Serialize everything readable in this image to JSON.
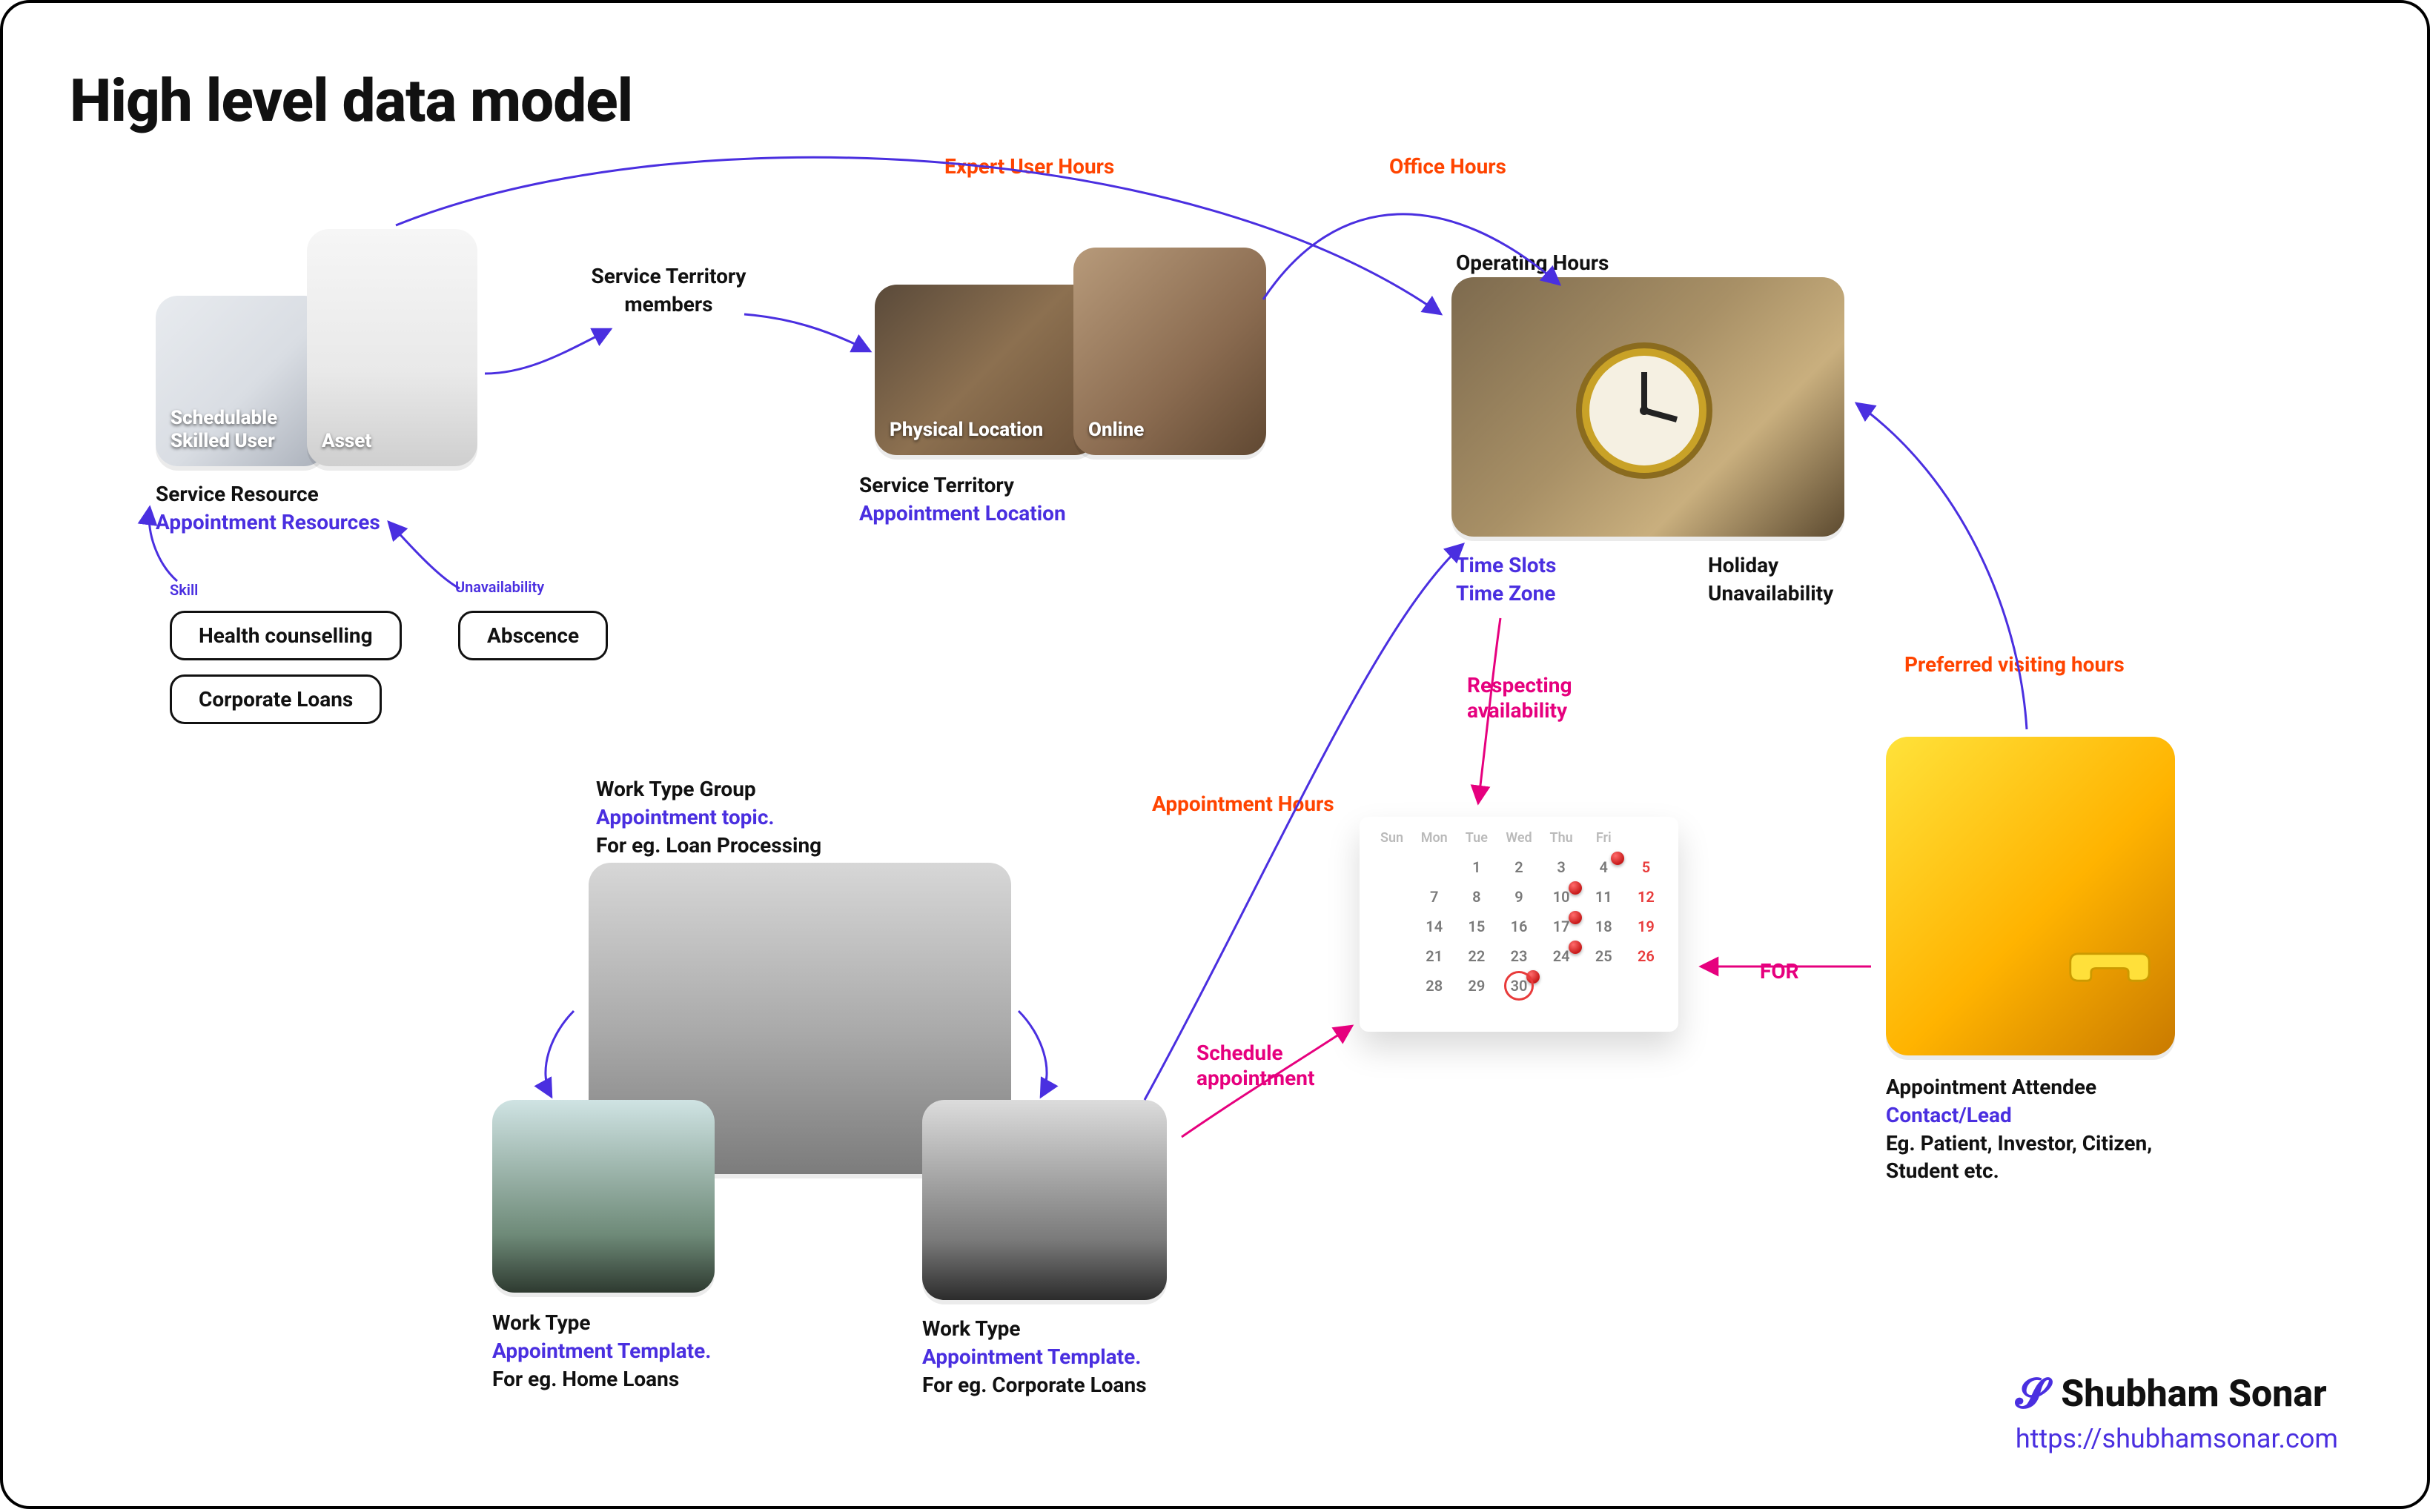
{
  "title": "High level data model",
  "service_resource": {
    "label": "Service Resource",
    "subtitle": "Appointment Resources",
    "skilled_user_caption": "Schedulable\nSkilled User",
    "asset_caption": "Asset",
    "skill_tag": "Skill",
    "unavailability_tag": "Unavailability",
    "skill_chips": [
      "Health counselling",
      "Corporate Loans"
    ],
    "absence_chip": "Abscence"
  },
  "territory_members": "Service Territory members",
  "service_territory": {
    "label": "Service Territory",
    "subtitle": "Appointment Location",
    "physical_caption": "Physical Location",
    "online_caption": "Online"
  },
  "operating_hours": {
    "label": "Operating Hours",
    "left_sub1": "Time Slots",
    "left_sub2": "Time Zone",
    "right_sub1": "Holiday",
    "right_sub2": "Unavailability"
  },
  "work_type_group": {
    "label": "Work Type Group",
    "subtitle": "Appointment topic.",
    "example": "For eg.  Loan Processing"
  },
  "work_type_left": {
    "label": "Work Type",
    "subtitle": "Appointment Template.",
    "example": "For eg. Home Loans"
  },
  "work_type_right": {
    "label": "Work Type",
    "subtitle": "Appointment Template.",
    "example": "For eg. Corporate Loans"
  },
  "appointment_attendee": {
    "label": "Appointment Attendee",
    "subtitle": "Contact/Lead",
    "example": "Eg. Patient, Investor, Citizen, Student etc."
  },
  "connectors": {
    "expert_user_hours": "Expert User Hours",
    "office_hours": "Office Hours",
    "appointment_hours": "Appointment Hours",
    "schedule_appointment": "Schedule appointment",
    "respecting_availability": "Respecting availability",
    "for": "FOR",
    "preferred_visiting_hours": "Preferred visiting hours"
  },
  "calendar": {
    "days": [
      "Sun",
      "Mon",
      "Tue",
      "Wed",
      "Thu",
      "Fri"
    ],
    "rows": [
      [
        "",
        "",
        "1",
        "2",
        "3",
        "4",
        "5"
      ],
      [
        "",
        "7",
        "8",
        "9",
        "10",
        "11",
        "12"
      ],
      [
        "",
        "14",
        "15",
        "16",
        "17",
        "18",
        "19"
      ],
      [
        "",
        "21",
        "22",
        "23",
        "24",
        "25",
        "26"
      ],
      [
        "",
        "28",
        "29",
        "30",
        "",
        "",
        ""
      ]
    ],
    "red_cells": [
      "5",
      "12",
      "19",
      "26"
    ],
    "circled": "30",
    "pinned": [
      "4",
      "10",
      "17",
      "24",
      "30"
    ]
  },
  "author": {
    "name": "Shubham Sonar",
    "url": "https://shubhamsonar.com"
  }
}
